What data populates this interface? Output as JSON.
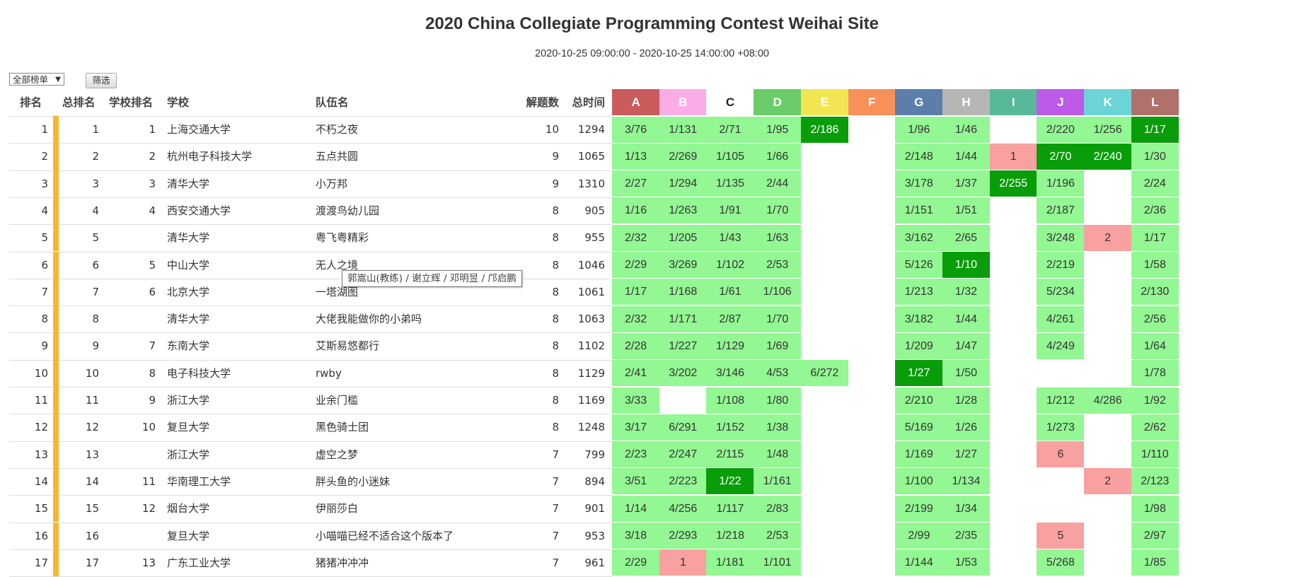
{
  "page": {
    "title": "2020 China Collegiate Programming Contest Weihai Site",
    "time_range": "2020-10-25 09:00:00 - 2020-10-25 14:00:00 +08:00"
  },
  "filters": {
    "list_select": "全部榜单",
    "filter_button": "筛选"
  },
  "headers": {
    "rank": "排名",
    "overall_rank": "总排名",
    "school_rank": "学校排名",
    "school": "学校",
    "team": "队伍名",
    "solved": "解题数",
    "penalty": "总时间"
  },
  "problems": [
    {
      "id": "A",
      "color": "#cc5b5b"
    },
    {
      "id": "B",
      "color": "#f9ace6"
    },
    {
      "id": "C",
      "color": "#ffffff"
    },
    {
      "id": "D",
      "color": "#6acd6a"
    },
    {
      "id": "E",
      "color": "#f2e553"
    },
    {
      "id": "F",
      "color": "#f79059"
    },
    {
      "id": "G",
      "color": "#5b7faa"
    },
    {
      "id": "H",
      "color": "#b6b6b6"
    },
    {
      "id": "I",
      "color": "#58b89a"
    },
    {
      "id": "J",
      "color": "#bd5ae9"
    },
    {
      "id": "K",
      "color": "#6cd4d6"
    },
    {
      "id": "L",
      "color": "#b0716d"
    }
  ],
  "status_colors": {
    "accepted": "#93f793",
    "first_blood": "#0a9d0a",
    "rejected": "#f9a0a0",
    "rank_bar": "#f5b72d"
  },
  "rows": [
    {
      "rank": "1",
      "overall": "1",
      "school_rank": "1",
      "school": "上海交通大学",
      "team": "不朽之夜",
      "solved": "10",
      "penalty": "1294",
      "results": [
        [
          "3/76",
          "ok"
        ],
        [
          "1/131",
          "ok"
        ],
        [
          "2/71",
          "ok"
        ],
        [
          "1/95",
          "ok"
        ],
        [
          "2/186",
          "first"
        ],
        [
          "",
          ""
        ],
        [
          "1/96",
          "ok"
        ],
        [
          "1/46",
          "ok"
        ],
        [
          "",
          ""
        ],
        [
          "2/220",
          "ok"
        ],
        [
          "1/256",
          "ok"
        ],
        [
          "1/17",
          "first"
        ]
      ]
    },
    {
      "rank": "2",
      "overall": "2",
      "school_rank": "2",
      "school": "杭州电子科技大学",
      "team": "五点共圆",
      "solved": "9",
      "penalty": "1065",
      "results": [
        [
          "1/13",
          "ok"
        ],
        [
          "2/269",
          "ok"
        ],
        [
          "1/105",
          "ok"
        ],
        [
          "1/66",
          "ok"
        ],
        [
          "",
          ""
        ],
        [
          "",
          ""
        ],
        [
          "2/148",
          "ok"
        ],
        [
          "1/44",
          "ok"
        ],
        [
          "1",
          "fail"
        ],
        [
          "2/70",
          "first"
        ],
        [
          "2/240",
          "first"
        ],
        [
          "1/30",
          "ok"
        ]
      ]
    },
    {
      "rank": "3",
      "overall": "3",
      "school_rank": "3",
      "school": "清华大学",
      "team": "小万邦",
      "solved": "9",
      "penalty": "1310",
      "results": [
        [
          "2/27",
          "ok"
        ],
        [
          "1/294",
          "ok"
        ],
        [
          "1/135",
          "ok"
        ],
        [
          "2/44",
          "ok"
        ],
        [
          "",
          ""
        ],
        [
          "",
          ""
        ],
        [
          "3/178",
          "ok"
        ],
        [
          "1/37",
          "ok"
        ],
        [
          "2/255",
          "first"
        ],
        [
          "1/196",
          "ok"
        ],
        [
          "",
          ""
        ],
        [
          "2/24",
          "ok"
        ]
      ]
    },
    {
      "rank": "4",
      "overall": "4",
      "school_rank": "4",
      "school": "西安交通大学",
      "team": "渡渡鸟幼儿园",
      "solved": "8",
      "penalty": "905",
      "results": [
        [
          "1/16",
          "ok"
        ],
        [
          "1/263",
          "ok"
        ],
        [
          "1/91",
          "ok"
        ],
        [
          "1/70",
          "ok"
        ],
        [
          "",
          ""
        ],
        [
          "",
          ""
        ],
        [
          "1/151",
          "ok"
        ],
        [
          "1/51",
          "ok"
        ],
        [
          "",
          ""
        ],
        [
          "2/187",
          "ok"
        ],
        [
          "",
          ""
        ],
        [
          "2/36",
          "ok"
        ]
      ]
    },
    {
      "rank": "5",
      "overall": "5",
      "school_rank": "",
      "school": "清华大学",
      "team": "粤飞粤精彩",
      "solved": "8",
      "penalty": "955",
      "results": [
        [
          "2/32",
          "ok"
        ],
        [
          "1/205",
          "ok"
        ],
        [
          "1/43",
          "ok"
        ],
        [
          "1/63",
          "ok"
        ],
        [
          "",
          ""
        ],
        [
          "",
          ""
        ],
        [
          "3/162",
          "ok"
        ],
        [
          "2/65",
          "ok"
        ],
        [
          "",
          ""
        ],
        [
          "3/248",
          "ok"
        ],
        [
          "2",
          "fail"
        ],
        [
          "1/17",
          "ok"
        ]
      ]
    },
    {
      "rank": "6",
      "overall": "6",
      "school_rank": "5",
      "school": "中山大学",
      "team": "无人之境",
      "solved": "8",
      "penalty": "1046",
      "results": [
        [
          "2/29",
          "ok"
        ],
        [
          "3/269",
          "ok"
        ],
        [
          "1/102",
          "ok"
        ],
        [
          "2/53",
          "ok"
        ],
        [
          "",
          ""
        ],
        [
          "",
          ""
        ],
        [
          "5/126",
          "ok"
        ],
        [
          "1/10",
          "first"
        ],
        [
          "",
          ""
        ],
        [
          "2/219",
          "ok"
        ],
        [
          "",
          ""
        ],
        [
          "1/58",
          "ok"
        ]
      ]
    },
    {
      "rank": "7",
      "overall": "7",
      "school_rank": "6",
      "school": "北京大学",
      "team": "一塔湖图",
      "solved": "8",
      "penalty": "1061",
      "results": [
        [
          "1/17",
          "ok"
        ],
        [
          "1/168",
          "ok"
        ],
        [
          "1/61",
          "ok"
        ],
        [
          "1/106",
          "ok"
        ],
        [
          "",
          ""
        ],
        [
          "",
          ""
        ],
        [
          "1/213",
          "ok"
        ],
        [
          "1/32",
          "ok"
        ],
        [
          "",
          ""
        ],
        [
          "5/234",
          "ok"
        ],
        [
          "",
          ""
        ],
        [
          "2/130",
          "ok"
        ]
      ]
    },
    {
      "rank": "8",
      "overall": "8",
      "school_rank": "",
      "school": "清华大学",
      "team": "大佬我能做你的小弟吗",
      "solved": "8",
      "penalty": "1063",
      "results": [
        [
          "2/32",
          "ok"
        ],
        [
          "1/171",
          "ok"
        ],
        [
          "2/87",
          "ok"
        ],
        [
          "1/70",
          "ok"
        ],
        [
          "",
          ""
        ],
        [
          "",
          ""
        ],
        [
          "3/182",
          "ok"
        ],
        [
          "1/44",
          "ok"
        ],
        [
          "",
          ""
        ],
        [
          "4/261",
          "ok"
        ],
        [
          "",
          ""
        ],
        [
          "2/56",
          "ok"
        ]
      ]
    },
    {
      "rank": "9",
      "overall": "9",
      "school_rank": "7",
      "school": "东南大学",
      "team": "艾斯易悠都行",
      "solved": "8",
      "penalty": "1102",
      "results": [
        [
          "2/28",
          "ok"
        ],
        [
          "1/227",
          "ok"
        ],
        [
          "1/129",
          "ok"
        ],
        [
          "1/69",
          "ok"
        ],
        [
          "",
          ""
        ],
        [
          "",
          ""
        ],
        [
          "1/209",
          "ok"
        ],
        [
          "1/47",
          "ok"
        ],
        [
          "",
          ""
        ],
        [
          "4/249",
          "ok"
        ],
        [
          "",
          ""
        ],
        [
          "1/64",
          "ok"
        ]
      ]
    },
    {
      "rank": "10",
      "overall": "10",
      "school_rank": "8",
      "school": "电子科技大学",
      "team": "rwby",
      "solved": "8",
      "penalty": "1129",
      "results": [
        [
          "2/41",
          "ok"
        ],
        [
          "3/202",
          "ok"
        ],
        [
          "3/146",
          "ok"
        ],
        [
          "4/53",
          "ok"
        ],
        [
          "6/272",
          "ok"
        ],
        [
          "",
          ""
        ],
        [
          "1/27",
          "first"
        ],
        [
          "1/50",
          "ok"
        ],
        [
          "",
          ""
        ],
        [
          "",
          ""
        ],
        [
          "",
          ""
        ],
        [
          "1/78",
          "ok"
        ]
      ]
    },
    {
      "rank": "11",
      "overall": "11",
      "school_rank": "9",
      "school": "浙江大学",
      "team": "业余门槛",
      "solved": "8",
      "penalty": "1169",
      "results": [
        [
          "3/33",
          "ok"
        ],
        [
          "",
          ""
        ],
        [
          "1/108",
          "ok"
        ],
        [
          "1/80",
          "ok"
        ],
        [
          "",
          ""
        ],
        [
          "",
          ""
        ],
        [
          "2/210",
          "ok"
        ],
        [
          "1/28",
          "ok"
        ],
        [
          "",
          ""
        ],
        [
          "1/212",
          "ok"
        ],
        [
          "4/286",
          "ok"
        ],
        [
          "1/92",
          "ok"
        ]
      ]
    },
    {
      "rank": "12",
      "overall": "12",
      "school_rank": "10",
      "school": "复旦大学",
      "team": "黑色骑士团",
      "solved": "8",
      "penalty": "1248",
      "results": [
        [
          "3/17",
          "ok"
        ],
        [
          "6/291",
          "ok"
        ],
        [
          "1/152",
          "ok"
        ],
        [
          "1/38",
          "ok"
        ],
        [
          "",
          ""
        ],
        [
          "",
          ""
        ],
        [
          "5/169",
          "ok"
        ],
        [
          "1/26",
          "ok"
        ],
        [
          "",
          ""
        ],
        [
          "1/273",
          "ok"
        ],
        [
          "",
          ""
        ],
        [
          "2/62",
          "ok"
        ]
      ]
    },
    {
      "rank": "13",
      "overall": "13",
      "school_rank": "",
      "school": "浙江大学",
      "team": "虚空之梦",
      "solved": "7",
      "penalty": "799",
      "results": [
        [
          "2/23",
          "ok"
        ],
        [
          "2/247",
          "ok"
        ],
        [
          "2/115",
          "ok"
        ],
        [
          "1/48",
          "ok"
        ],
        [
          "",
          ""
        ],
        [
          "",
          ""
        ],
        [
          "1/169",
          "ok"
        ],
        [
          "1/27",
          "ok"
        ],
        [
          "",
          ""
        ],
        [
          "6",
          "fail"
        ],
        [
          "",
          ""
        ],
        [
          "1/110",
          "ok"
        ]
      ]
    },
    {
      "rank": "14",
      "overall": "14",
      "school_rank": "11",
      "school": "华南理工大学",
      "team": "胖头鱼的小迷妹",
      "solved": "7",
      "penalty": "894",
      "results": [
        [
          "3/51",
          "ok"
        ],
        [
          "2/223",
          "ok"
        ],
        [
          "1/22",
          "first"
        ],
        [
          "1/161",
          "ok"
        ],
        [
          "",
          ""
        ],
        [
          "",
          ""
        ],
        [
          "1/100",
          "ok"
        ],
        [
          "1/134",
          "ok"
        ],
        [
          "",
          ""
        ],
        [
          "",
          ""
        ],
        [
          "2",
          "fail"
        ],
        [
          "2/123",
          "ok"
        ]
      ]
    },
    {
      "rank": "15",
      "overall": "15",
      "school_rank": "12",
      "school": "烟台大学",
      "team": "伊丽莎白",
      "solved": "7",
      "penalty": "901",
      "results": [
        [
          "1/14",
          "ok"
        ],
        [
          "4/256",
          "ok"
        ],
        [
          "1/117",
          "ok"
        ],
        [
          "2/83",
          "ok"
        ],
        [
          "",
          ""
        ],
        [
          "",
          ""
        ],
        [
          "2/199",
          "ok"
        ],
        [
          "1/34",
          "ok"
        ],
        [
          "",
          ""
        ],
        [
          "",
          ""
        ],
        [
          "",
          ""
        ],
        [
          "1/98",
          "ok"
        ]
      ]
    },
    {
      "rank": "16",
      "overall": "16",
      "school_rank": "",
      "school": "复旦大学",
      "team": "小喵喵已经不适合这个版本了",
      "solved": "7",
      "penalty": "953",
      "results": [
        [
          "3/18",
          "ok"
        ],
        [
          "2/293",
          "ok"
        ],
        [
          "1/218",
          "ok"
        ],
        [
          "2/53",
          "ok"
        ],
        [
          "",
          ""
        ],
        [
          "",
          ""
        ],
        [
          "2/99",
          "ok"
        ],
        [
          "2/35",
          "ok"
        ],
        [
          "",
          ""
        ],
        [
          "5",
          "fail"
        ],
        [
          "",
          ""
        ],
        [
          "2/97",
          "ok"
        ]
      ]
    },
    {
      "rank": "17",
      "overall": "17",
      "school_rank": "13",
      "school": "广东工业大学",
      "team": "猪猪冲冲冲",
      "solved": "7",
      "penalty": "961",
      "results": [
        [
          "2/29",
          "ok"
        ],
        [
          "1",
          "fail"
        ],
        [
          "1/181",
          "ok"
        ],
        [
          "1/101",
          "ok"
        ],
        [
          "",
          ""
        ],
        [
          "",
          ""
        ],
        [
          "1/144",
          "ok"
        ],
        [
          "1/53",
          "ok"
        ],
        [
          "",
          ""
        ],
        [
          "5/268",
          "ok"
        ],
        [
          "",
          ""
        ],
        [
          "1/85",
          "ok"
        ]
      ]
    }
  ],
  "tooltip": "郭嵩山(教练) / 谢立辉 / 邓明昱 / 邝启鹏"
}
